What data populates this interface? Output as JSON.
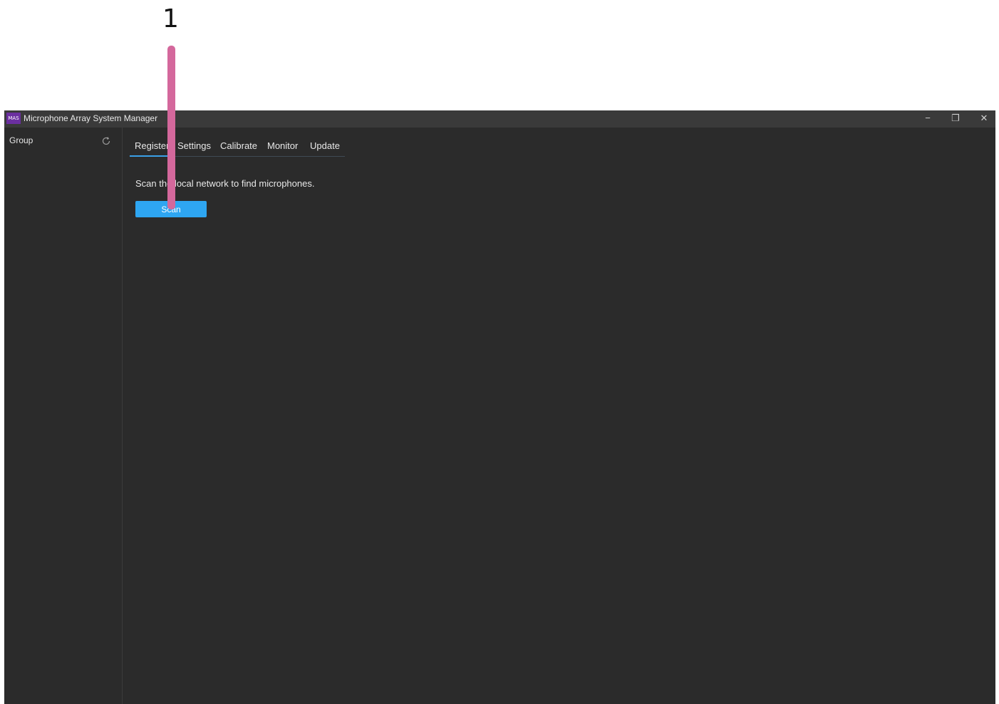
{
  "callout": {
    "number": "1"
  },
  "window": {
    "logo_text": "MAS",
    "title": "Microphone Array System Manager",
    "controls": {
      "minimize": "−",
      "restore": "❐",
      "close": "✕"
    }
  },
  "sidebar": {
    "header": "Group"
  },
  "tabs": [
    {
      "label": "Register",
      "active": true
    },
    {
      "label": "Settings",
      "active": false
    },
    {
      "label": "Calibrate",
      "active": false
    },
    {
      "label": "Monitor",
      "active": false
    },
    {
      "label": "Update",
      "active": false
    }
  ],
  "register": {
    "instruction": "Scan the local network to find microphones.",
    "scan_label": "Scan"
  },
  "colors": {
    "accent": "#2ea6f2",
    "callout": "#d4689c",
    "background": "#2b2b2b",
    "titlebar": "#3a3a3a"
  }
}
